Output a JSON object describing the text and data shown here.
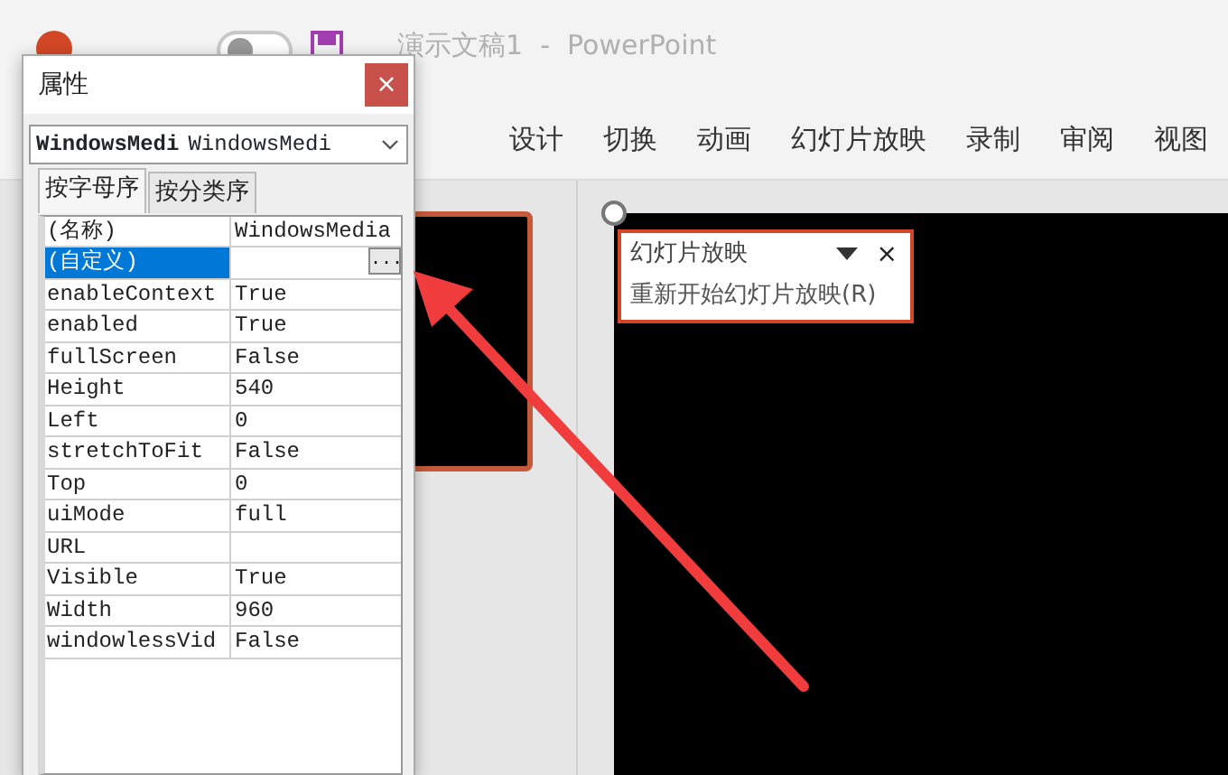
{
  "title_bar": {
    "autosave_toggle": {
      "on": false
    },
    "document_title": "演示文稿1  -  PowerPoint"
  },
  "ribbon_tabs": [
    {
      "label": "设计",
      "selected": false
    },
    {
      "label": "切换",
      "selected": false
    },
    {
      "label": "动画",
      "selected": false
    },
    {
      "label": "幻灯片放映",
      "selected": false
    },
    {
      "label": "录制",
      "selected": false
    },
    {
      "label": "审阅",
      "selected": false
    },
    {
      "label": "视图",
      "selected": false
    }
  ],
  "properties_dialog": {
    "title": "属性",
    "close": "×",
    "object_combo": {
      "name": "WindowsMedi",
      "type": "WindowsMedi"
    },
    "tabs": [
      {
        "label": "按字母序",
        "selected": true
      },
      {
        "label": "按分类序",
        "selected": false
      }
    ],
    "properties": [
      {
        "name": "(名称)",
        "value": "WindowsMedia",
        "selected": false
      },
      {
        "name": "(自定义)",
        "selected": true,
        "button": "..."
      },
      {
        "name": "enableContext",
        "value": "True",
        "selected": false
      },
      {
        "name": "enabled",
        "value": "True",
        "selected": false
      },
      {
        "name": "fullScreen",
        "value": "False",
        "selected": false
      },
      {
        "name": "Height",
        "value": "540",
        "selected": false
      },
      {
        "name": "Left",
        "value": "0",
        "selected": false
      },
      {
        "name": "stretchToFit",
        "value": "False",
        "selected": false
      },
      {
        "name": "Top",
        "value": "0",
        "selected": false
      },
      {
        "name": "uiMode",
        "value": "full",
        "selected": false
      },
      {
        "name": "URL",
        "selected": false
      },
      {
        "name": "Visible",
        "value": "True",
        "selected": false
      },
      {
        "name": "Width",
        "value": "960",
        "selected": false
      },
      {
        "name": "windowlessVid",
        "value": "False",
        "selected": false
      }
    ]
  },
  "slideshow_popup": {
    "title": "幻灯片放映",
    "close": "×",
    "command": "重新开始幻灯片放映(R)"
  }
}
